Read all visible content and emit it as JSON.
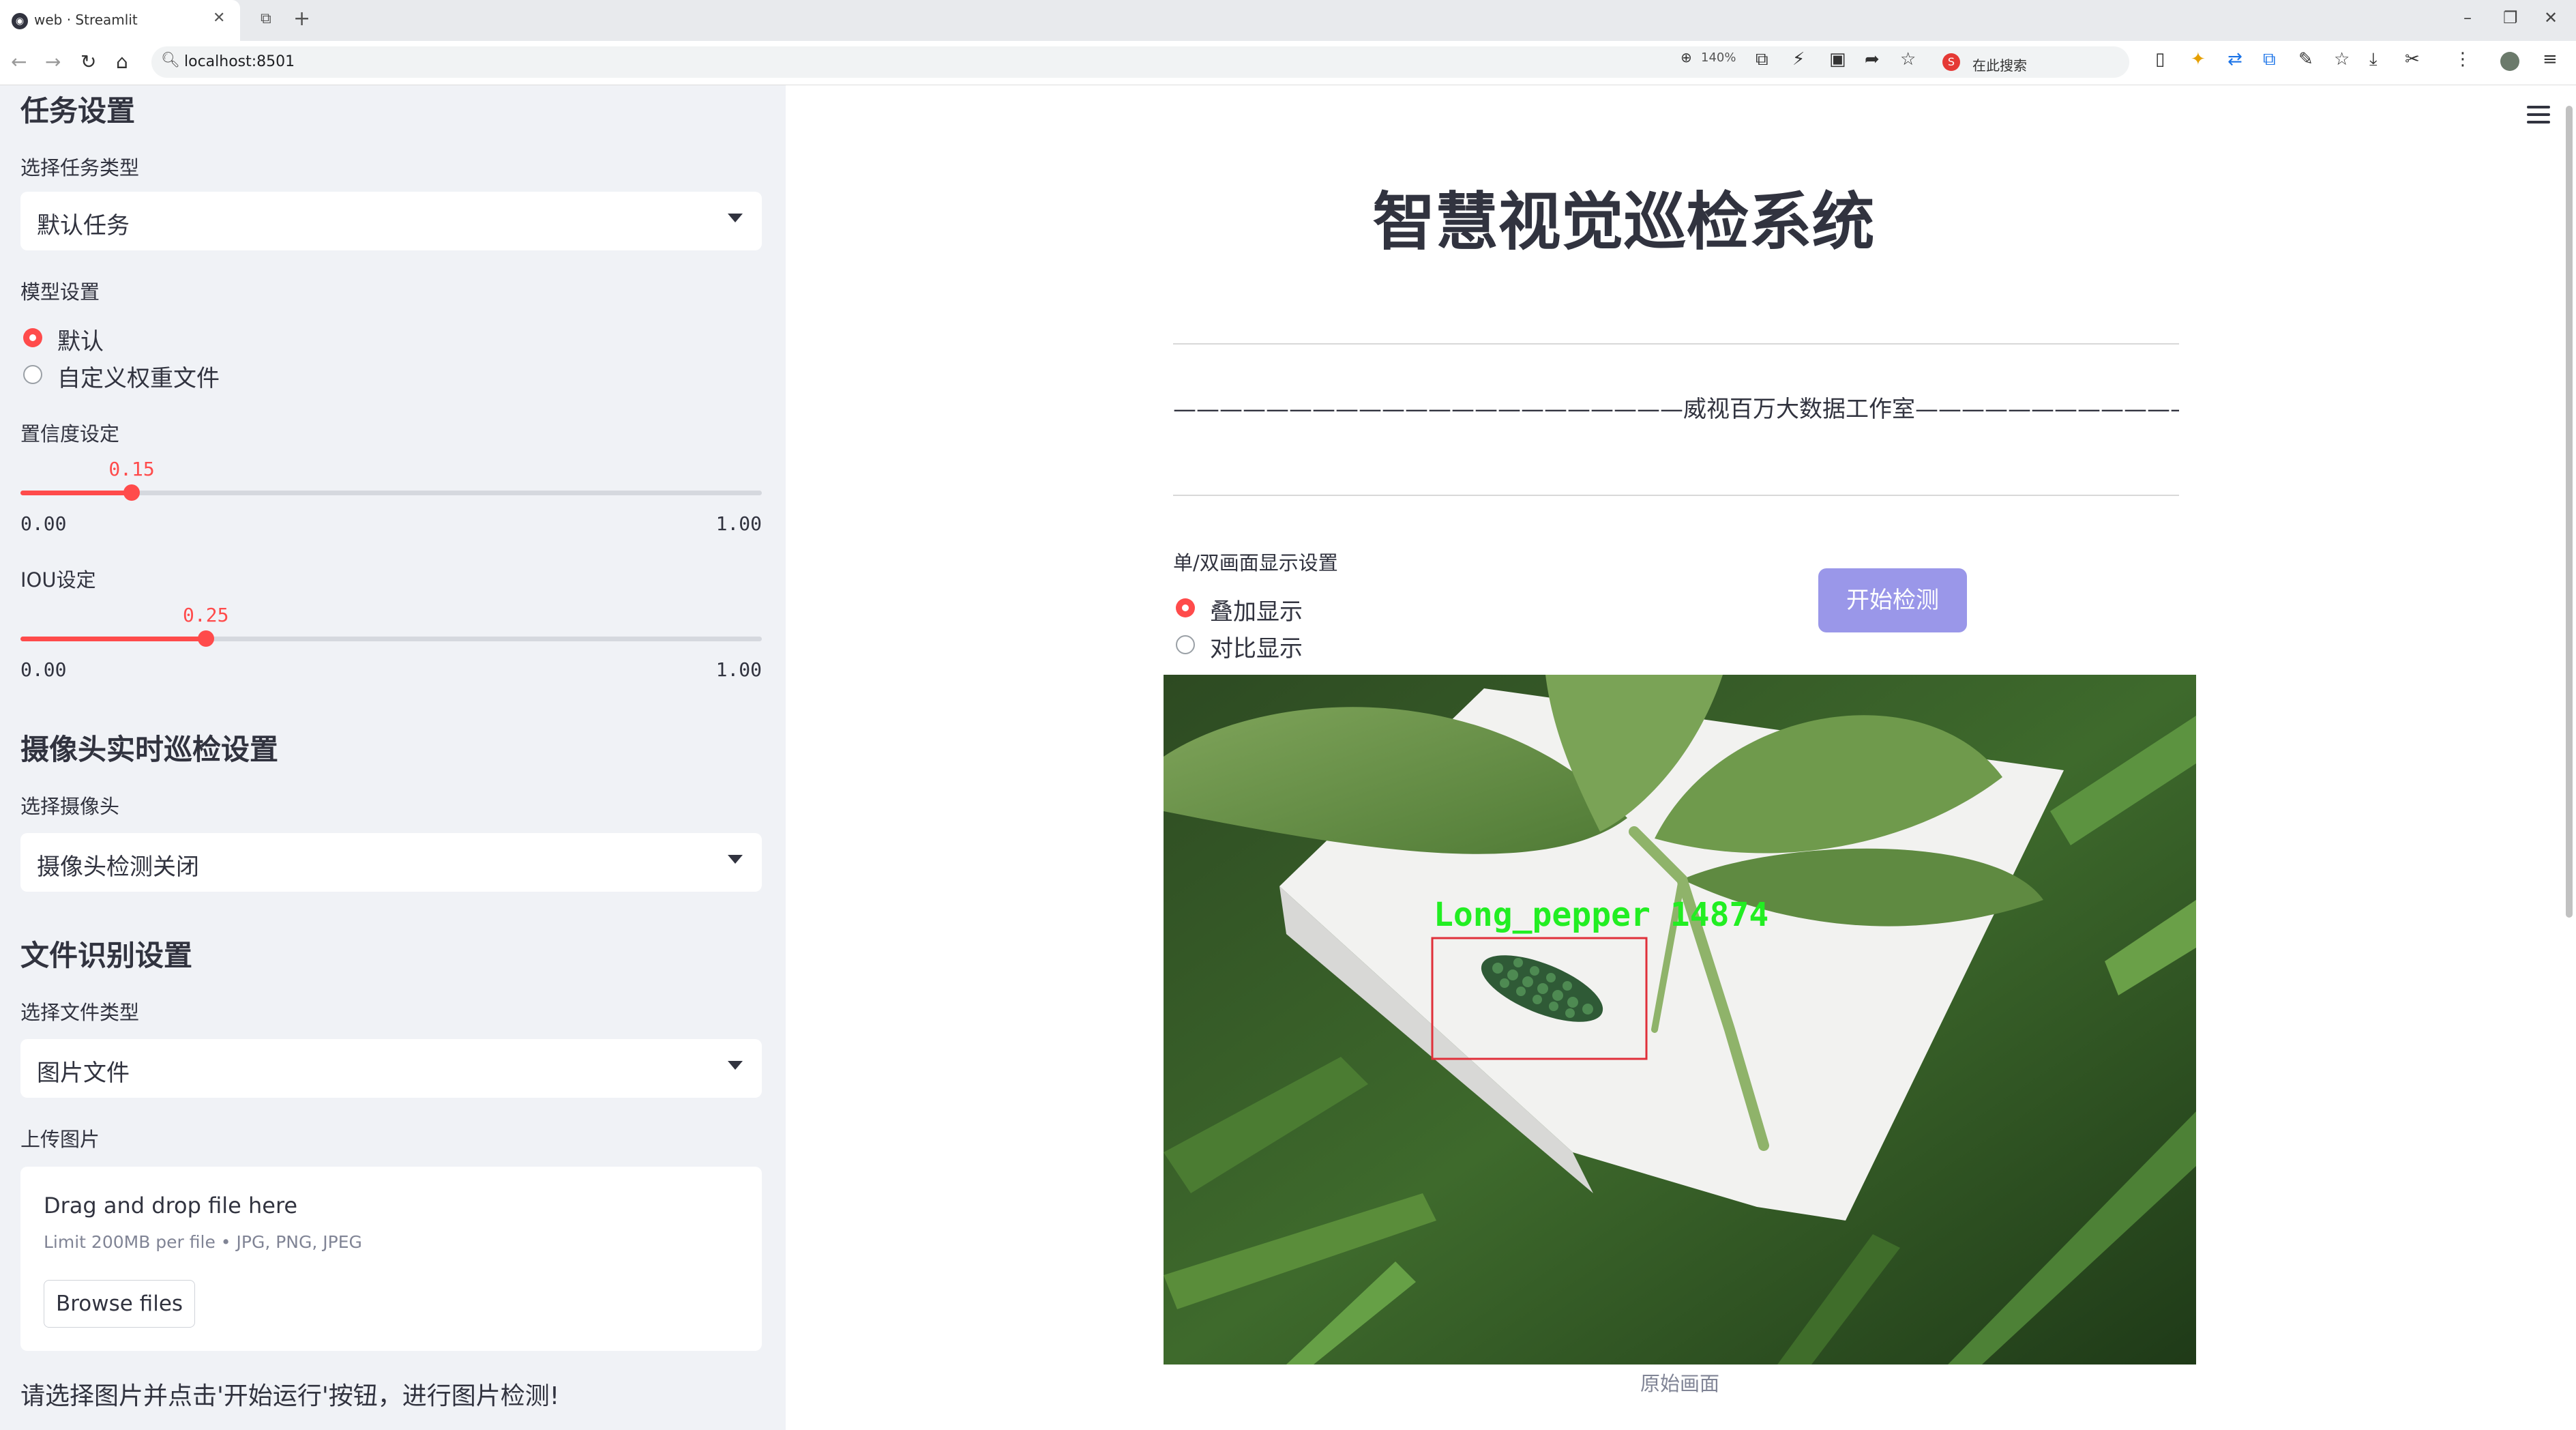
{
  "browser": {
    "tab_title": "web · Streamlit",
    "tab_favicon": "streamlit-icon",
    "url": "localhost:8501",
    "zoom": "140%",
    "search_placeholder": "在此搜索"
  },
  "sidebar": {
    "task_section_title": "任务设置",
    "task_type_label": "选择任务类型",
    "task_type_value": "默认任务",
    "model_label": "模型设置",
    "model_options": [
      {
        "label": "默认",
        "selected": true
      },
      {
        "label": "自定义权重文件",
        "selected": false
      }
    ],
    "confidence": {
      "label": "置信度设定",
      "value": "0.15",
      "fraction": 0.15,
      "min": "0.00",
      "max": "1.00"
    },
    "iou": {
      "label": "IOU设定",
      "value": "0.25",
      "fraction": 0.25,
      "min": "0.00",
      "max": "1.00"
    },
    "camera_section_title": "摄像头实时巡检设置",
    "camera_label": "选择摄像头",
    "camera_value": "摄像头检测关闭",
    "file_section_title": "文件识别设置",
    "file_type_label": "选择文件类型",
    "file_type_value": "图片文件",
    "upload_label": "上传图片",
    "uploader": {
      "title": "Drag and drop file here",
      "limit": "Limit 200MB per file • JPG, PNG, JPEG",
      "browse_label": "Browse files"
    },
    "hint": "请选择图片并点击'开始运行'按钮，进行图片检测!"
  },
  "main": {
    "title": "智慧视觉巡检系统",
    "subtitle": "——————————————————————威视百万大数据工作室———————————————————————",
    "display_label": "单/双画面显示设置",
    "display_options": [
      {
        "label": "叠加显示",
        "selected": true
      },
      {
        "label": "对比显示",
        "selected": false
      }
    ],
    "start_button": "开始检测",
    "detection_label": "Long_pepper  14874",
    "image_caption": "原始画面"
  },
  "colors": {
    "accent": "#ff4b4b",
    "button": "#9a97e9",
    "sidebar_bg": "#f0f2f6",
    "detection_box": "#e0303a",
    "detection_text": "#22ee22"
  }
}
